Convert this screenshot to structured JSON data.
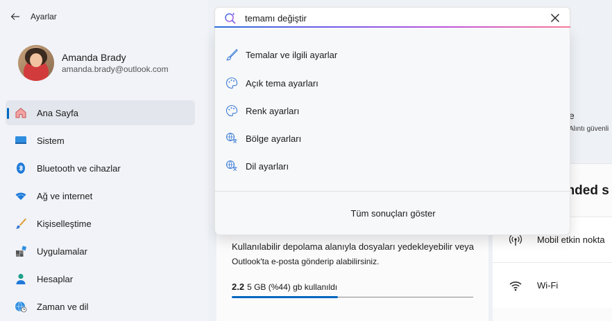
{
  "window": {
    "title": "Ayarlar"
  },
  "profile": {
    "name": "Amanda Brady",
    "email": "amanda.brady@outlook.com"
  },
  "nav": {
    "items": [
      {
        "label": "Ana Sayfa",
        "icon": "home-icon",
        "active": true
      },
      {
        "label": "Sistem",
        "icon": "system-icon"
      },
      {
        "label": "Bluetooth ve cihazlar",
        "icon": "bluetooth-icon"
      },
      {
        "label": "Ağ ve internet",
        "icon": "wifi-icon"
      },
      {
        "label": "Kişiselleştime",
        "icon": "brush-icon"
      },
      {
        "label": "Uygulamalar",
        "icon": "apps-icon"
      },
      {
        "label": "Hesaplar",
        "icon": "person-icon"
      },
      {
        "label": "Zaman ve dil",
        "icon": "globe-clock-icon"
      }
    ]
  },
  "search": {
    "value": "temamı değiştir",
    "results": [
      {
        "label": "Temalar ve ilgili ayarlar",
        "icon": "brush-icon"
      },
      {
        "label": "Açık tema ayarları",
        "icon": "palette-icon"
      },
      {
        "label": "Renk ayarları",
        "icon": "palette-icon"
      },
      {
        "label": "Bölge ayarları",
        "icon": "language-icon"
      },
      {
        "label": "Dil ayarları",
        "icon": "language-icon"
      }
    ],
    "show_all": "Tüm sonuçları göster"
  },
  "main": {
    "top_card": {
      "line1": "e",
      "line2": "Alıntı güvenli"
    },
    "recommended": {
      "heading": "ended s",
      "items": [
        {
          "label": "Mobil etkin nokta",
          "icon": "hotspot-icon"
        },
        {
          "label": "Wi-Fi",
          "icon": "wifi-icon"
        }
      ]
    },
    "storage": {
      "desc1": "Kullanılabilir depolama alanıyla dosyaları yedekleyebilir veya",
      "desc2": "Outlook'ta e-posta gönderip alabilirsiniz.",
      "used": "2.2",
      "usage_text": "5 GB (%44) gb kullanıldı",
      "percent": 44
    }
  },
  "colors": {
    "accent": "#0067c0"
  }
}
